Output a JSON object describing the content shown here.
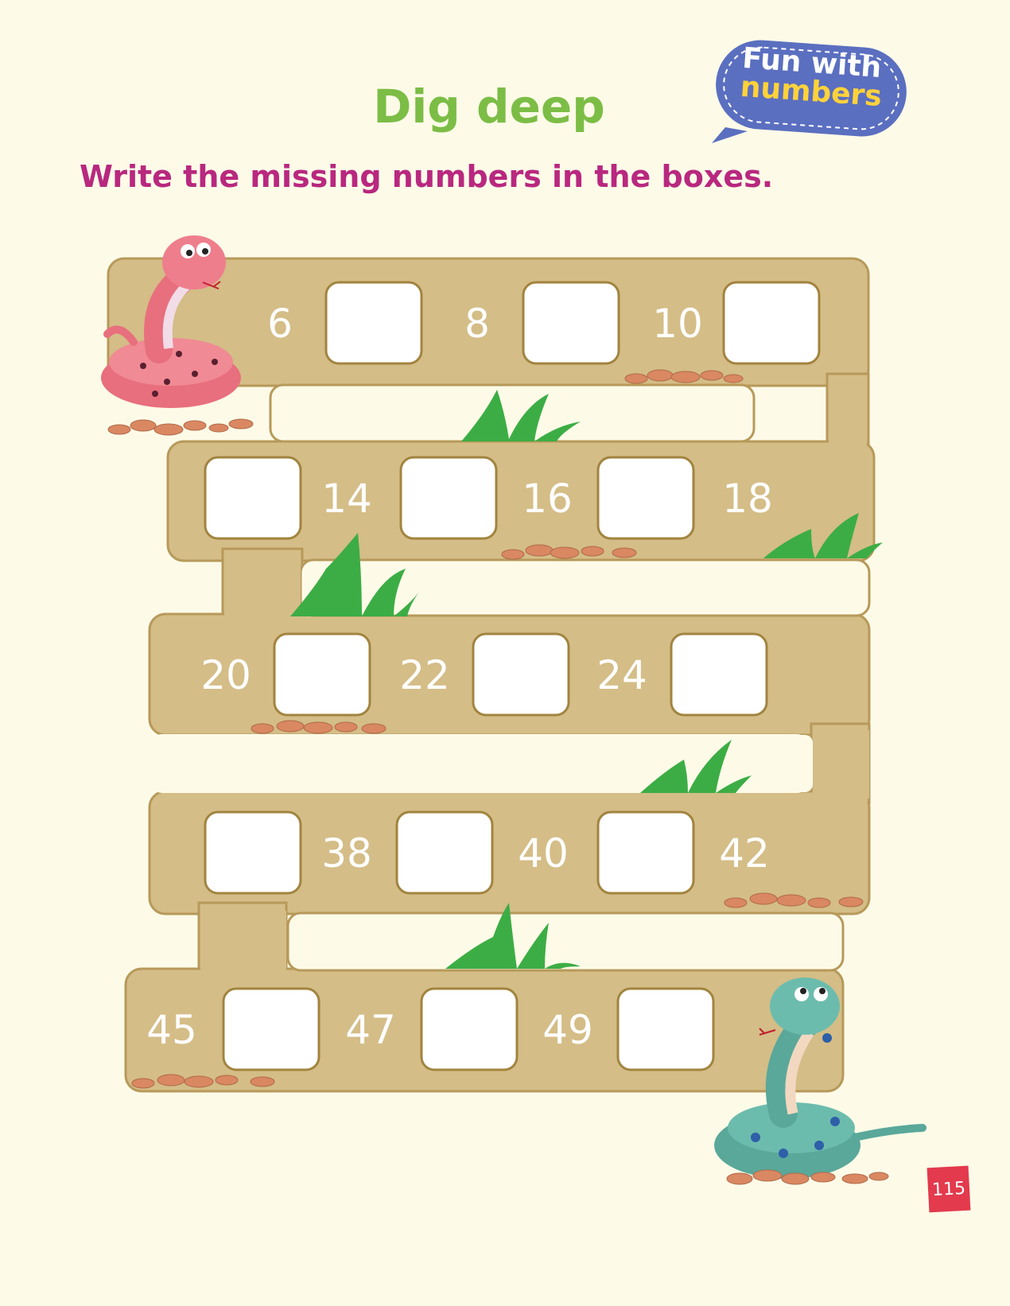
{
  "title": "Dig deep",
  "badge": {
    "line1": "Fun with",
    "line2": "numbers"
  },
  "instruction": "Write the missing numbers in the boxes.",
  "page_number": "115",
  "colors": {
    "path": "#d4bd87",
    "path_border": "#b7995a",
    "box_border": "#a2843f",
    "title": "#7cbd46",
    "instruction": "#b8287f",
    "badge": "#5b6fc0"
  },
  "rows": [
    {
      "cells": [
        "6",
        null,
        "8",
        null,
        "10",
        null
      ]
    },
    {
      "cells": [
        null,
        "14",
        null,
        "16",
        null,
        "18"
      ]
    },
    {
      "cells": [
        "20",
        null,
        "22",
        null,
        "24",
        null
      ]
    },
    {
      "cells": [
        null,
        "38",
        null,
        "40",
        null,
        "42"
      ]
    },
    {
      "cells": [
        "45",
        null,
        "47",
        null,
        "49",
        null
      ]
    }
  ]
}
